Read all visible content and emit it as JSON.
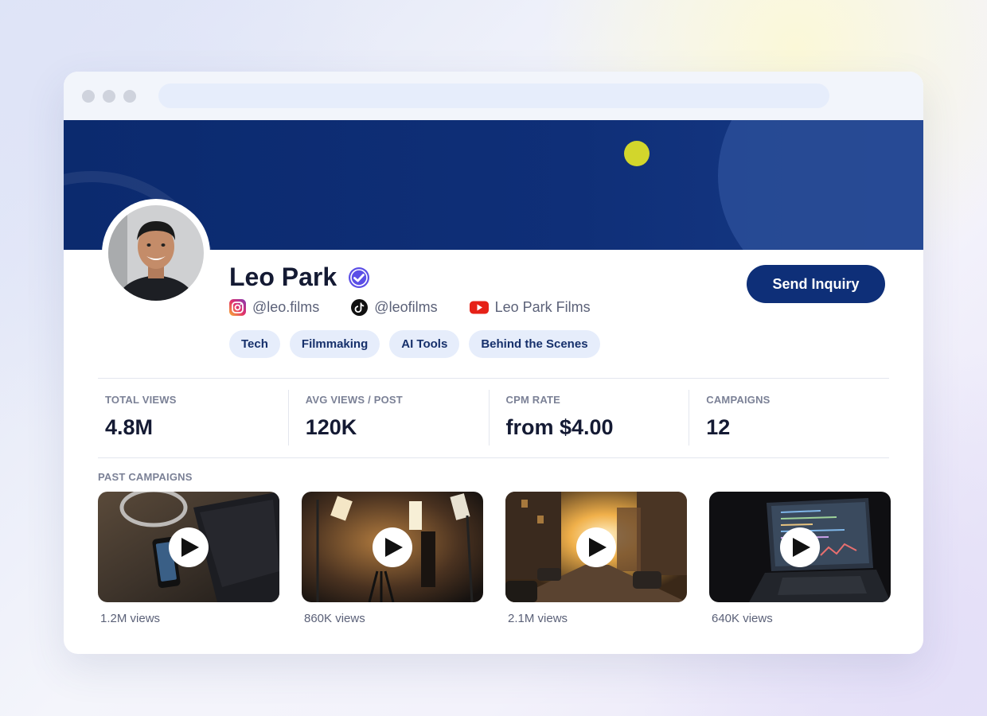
{
  "profile": {
    "name": "Leo Park",
    "socials": [
      {
        "platform": "instagram",
        "handle": "@leo.films"
      },
      {
        "platform": "tiktok",
        "handle": "@leofilms"
      },
      {
        "platform": "youtube",
        "handle": "Leo Park Films"
      }
    ],
    "tags": [
      "Tech",
      "Filmmaking",
      "AI Tools",
      "Behind the Scenes"
    ],
    "cta_label": "Send Inquiry"
  },
  "stats": [
    {
      "label": "TOTAL VIEWS",
      "value": "4.8M"
    },
    {
      "label": "AVG VIEWS / POST",
      "value": "120K"
    },
    {
      "label": "CPM RATE",
      "value": "from $4.00"
    },
    {
      "label": "CAMPAIGNS",
      "value": "12"
    }
  ],
  "past_campaigns": {
    "label": "PAST CAMPAIGNS",
    "items": [
      {
        "views": "1.2M views"
      },
      {
        "views": "860K views"
      },
      {
        "views": "2.1M views"
      },
      {
        "views": "640K views"
      }
    ]
  },
  "colors": {
    "brand_navy": "#0e2f78",
    "tag_bg": "#e6edfb",
    "accent_yellow": "#d2d62c",
    "verified": "#5b4ee6"
  },
  "icons": {
    "verified": "verified-check-icon",
    "instagram": "instagram-icon",
    "tiktok": "tiktok-icon",
    "youtube": "youtube-icon",
    "play": "play-icon"
  }
}
